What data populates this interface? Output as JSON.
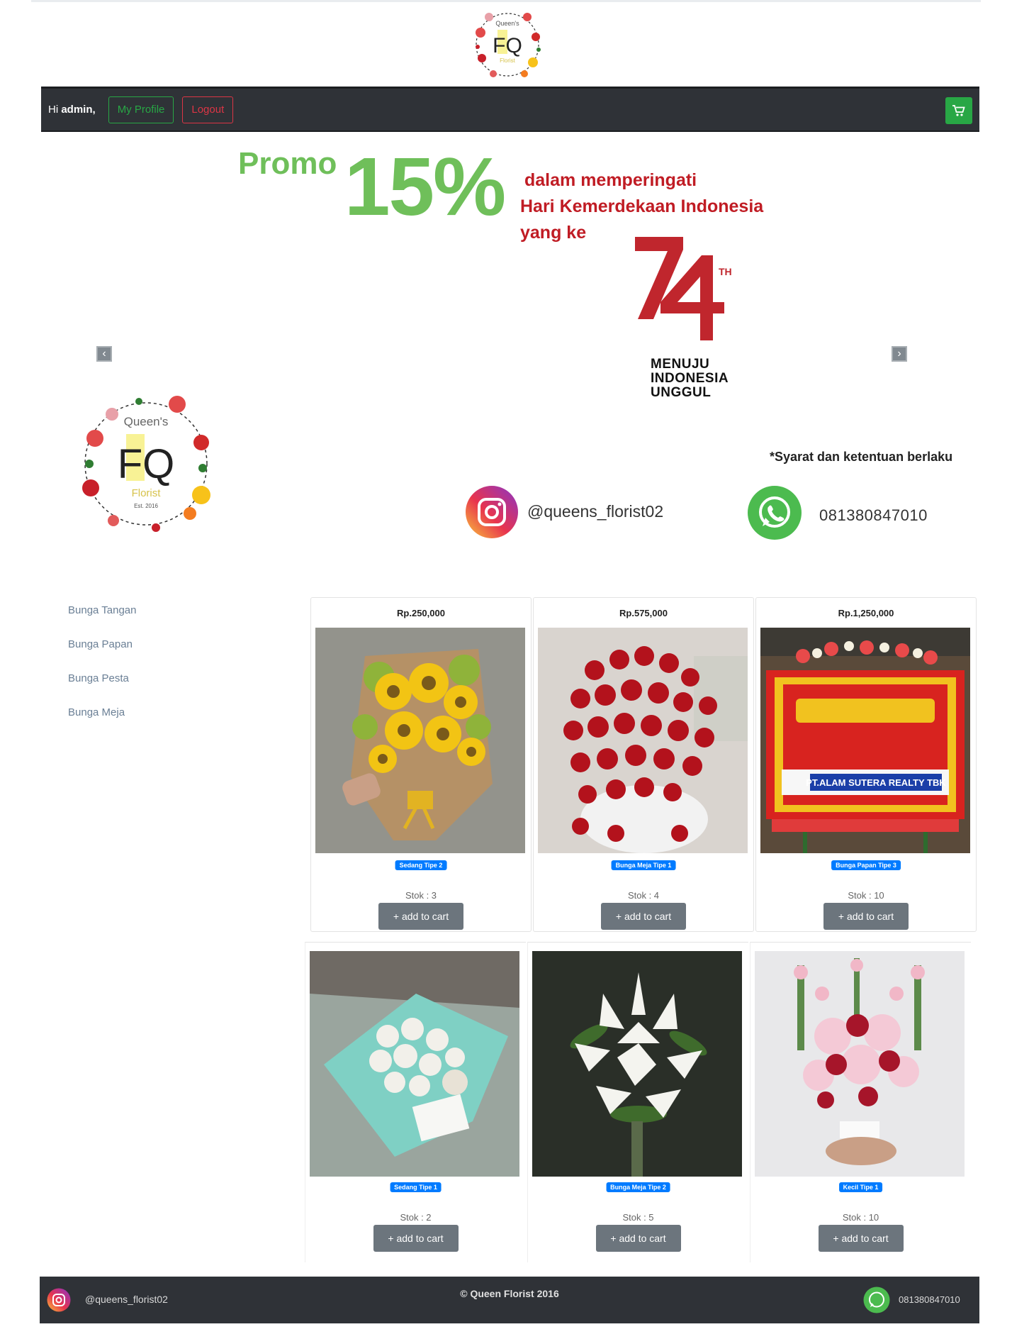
{
  "brand": {
    "logo_top_text": "Queen's",
    "logo_letters": "FQ",
    "logo_bottom_text": "Florist",
    "logo_est": "Est. 2016"
  },
  "navbar": {
    "greeting_prefix": "Hi",
    "username": "admin,",
    "profile_label": "My Profile",
    "logout_label": "Logout"
  },
  "banner": {
    "promo_word": "Promo",
    "promo_percent": "15%",
    "line1": "dalam memperingati",
    "line2": "Hari Kemerdekaan Indonesia",
    "line3": "yang ke",
    "anniv_th": "TH",
    "tagline": [
      "MENUJU",
      "INDONESIA",
      "UNGGUL"
    ],
    "terms": "*Syarat dan ketentuan berlaku",
    "instagram": "@queens_florist02",
    "whatsapp": "081380847010"
  },
  "sidebar": {
    "items": [
      {
        "label": "Bunga Tangan"
      },
      {
        "label": "Bunga Papan"
      },
      {
        "label": "Bunga Pesta"
      },
      {
        "label": "Bunga Meja"
      }
    ]
  },
  "products": [
    {
      "price": "Rp.250,000",
      "name": "Sedang Tipe 2",
      "stock": "Stok : 3",
      "button": "+ add to cart",
      "image": "sunflower-bouquet"
    },
    {
      "price": "Rp.575,000",
      "name": "Bunga Meja Tipe 1",
      "stock": "Stok : 4",
      "button": "+ add to cart",
      "image": "red-rose-table-arrangement"
    },
    {
      "price": "Rp.1,250,000",
      "name": "Bunga Papan Tipe 3",
      "stock": "Stok : 10",
      "button": "+ add to cart",
      "image": "wedding-flower-board"
    },
    {
      "price": "",
      "name": "Sedang Tipe 1",
      "stock": "Stok : 2",
      "button": "+ add to cart",
      "image": "white-rose-bouquet"
    },
    {
      "price": "",
      "name": "Bunga Meja Tipe 2",
      "stock": "Stok : 5",
      "button": "+ add to cart",
      "image": "white-lily-arrangement"
    },
    {
      "price": "",
      "name": "Kecil Tipe 1",
      "stock": "Stok : 10",
      "button": "+ add to cart",
      "image": "pink-hand-bouquet"
    }
  ],
  "footer": {
    "instagram": "@queens_florist02",
    "copyright": "© Queen Florist 2016",
    "whatsapp": "081380847010"
  },
  "colors": {
    "navbar_bg": "#2f3237",
    "success": "#28a745",
    "danger": "#dc3545",
    "primary": "#007bff",
    "secondary": "#6c757d",
    "promo_green": "#6fbf5a",
    "promo_red": "#c01c24"
  },
  "icons": {
    "cart": "cart-icon",
    "instagram": "instagram-icon",
    "whatsapp": "whatsapp-icon",
    "prev": "chevron-left-icon",
    "next": "chevron-right-icon"
  }
}
